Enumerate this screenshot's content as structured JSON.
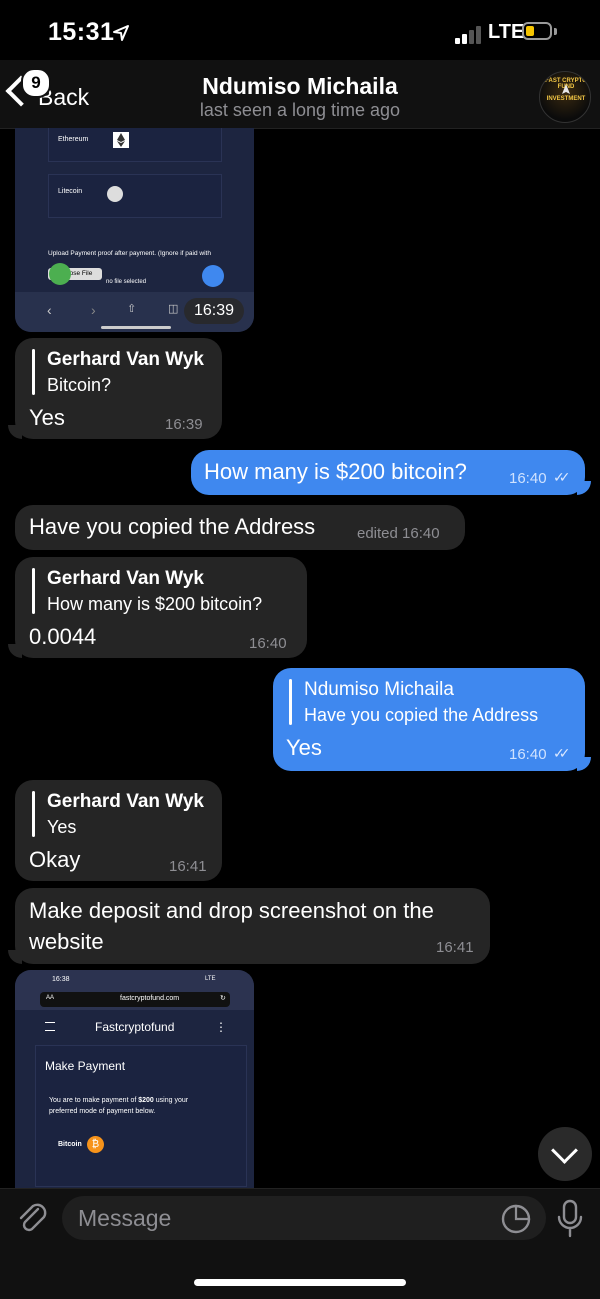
{
  "status_bar": {
    "time": "15:31",
    "location_icon": "location-arrow-icon",
    "network": "LTE"
  },
  "header": {
    "back_label": "Back",
    "unread_count": "9",
    "contact_name": "Ndumiso Michaila",
    "contact_status": "last seen a long time ago",
    "avatar_line1": "FAST CRYPTO FUND",
    "avatar_line2": "INVESTMENT"
  },
  "image1": {
    "coin1": "Ethereum",
    "coin2": "Litecoin",
    "upload_text": "Upload Payment proof after payment. (Ignore if paid with",
    "choose_file": "Choose File",
    "no_file": "no file selected",
    "time": "16:39"
  },
  "messages": [
    {
      "reply_name": "Gerhard Van Wyk",
      "reply_text": "Bitcoin?",
      "text": "Yes",
      "time": "16:39"
    },
    {
      "text": "How many is $200 bitcoin?",
      "time": "16:40"
    },
    {
      "text": "Have you copied the Address",
      "time": "edited 16:40"
    },
    {
      "reply_name": "Gerhard Van Wyk",
      "reply_text": "How many is $200 bitcoin?",
      "text": "0.0044",
      "time": "16:40"
    },
    {
      "reply_name": "Ndumiso Michaila",
      "reply_text": "Have you copied the Address",
      "text": "Yes",
      "time": "16:40"
    },
    {
      "reply_name": "Gerhard Van Wyk",
      "reply_text": "Yes",
      "text": "Okay",
      "time": "16:41"
    },
    {
      "text_line1": "Make deposit and drop screenshot on the",
      "text_line2": "website",
      "time": "16:41"
    }
  ],
  "image2": {
    "time": "16:38",
    "net": "LTE",
    "url_aa": "AA",
    "url": "fastcryptofund.com",
    "site_title": "Fastcryptofund",
    "heading": "Make Payment",
    "desc_prefix": "You are to make payment of ",
    "amount": "$200",
    "desc_suffix": " using your",
    "desc_line2": "preferred mode of payment below.",
    "coin": "Bitcoin"
  },
  "input": {
    "placeholder": "Message"
  },
  "colors": {
    "outgoing": "#3f88ef",
    "incoming": "#252525",
    "background": "#000000"
  }
}
